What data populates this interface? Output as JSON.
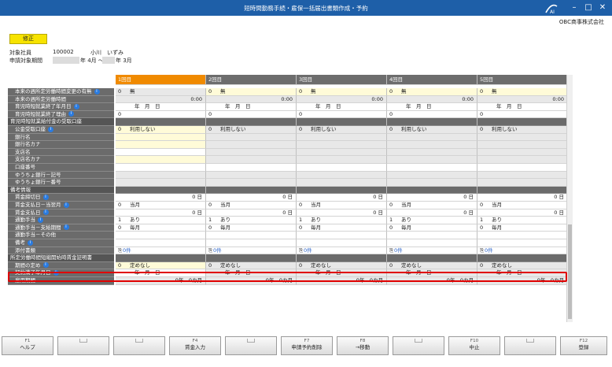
{
  "window": {
    "title": "短時間勤務手続・雇保一括届出書類作成・予約",
    "company": "OBC商事株式会社",
    "logo_text": "AI"
  },
  "status_button": "修正",
  "employee": {
    "label": "対象社員",
    "code": "100002",
    "name": "小川　いずみ"
  },
  "period": {
    "label": "申請対象期間",
    "start": "年 4月 ～",
    "end": "年 3月"
  },
  "columns": [
    "1回目",
    "2回目",
    "3回目",
    "4回目",
    "5回目"
  ],
  "rows": [
    {
      "label": "本来の週所定労働時間変更の有無",
      "info": true,
      "style": "yellow",
      "cells": [
        {
          "num": "0",
          "txt": "無",
          "gray": true
        },
        {
          "num": "0",
          "txt": "無"
        },
        {
          "num": "0",
          "txt": "無"
        },
        {
          "num": "0",
          "txt": "無"
        },
        {
          "num": "0",
          "txt": "無"
        }
      ]
    },
    {
      "label": "本来の週所定労働時間",
      "info": false,
      "style": "gray",
      "cells": [
        {
          "right": "0:00"
        },
        {
          "right": "0:00"
        },
        {
          "right": "0:00"
        },
        {
          "right": "0:00"
        },
        {
          "right": "0:00"
        }
      ]
    },
    {
      "label": "育児時短就業終了年月日",
      "info": true,
      "style": "white",
      "cells": [
        {
          "date": "年　月　日"
        },
        {
          "date": "年　月　日"
        },
        {
          "date": "年　月　日"
        },
        {
          "date": "年　月　日"
        },
        {
          "date": "年　月　日"
        }
      ]
    },
    {
      "label": "育児時短就業終了理由",
      "info": true,
      "style": "white",
      "cells": [
        {
          "num": "0"
        },
        {
          "num": "0"
        },
        {
          "num": "0"
        },
        {
          "num": "0"
        },
        {
          "num": "0"
        }
      ]
    },
    {
      "label": "育児時短就業給付金の受取口座",
      "section": true
    },
    {
      "label": "公金受取口座",
      "info": true,
      "style": "yellow",
      "cells": [
        {
          "num": "0",
          "txt": "利用しない"
        },
        {
          "num": "0",
          "txt": "利用しない",
          "gray": true
        },
        {
          "num": "0",
          "txt": "利用しない",
          "gray": true
        },
        {
          "num": "0",
          "txt": "利用しない",
          "gray": true
        },
        {
          "num": "0",
          "txt": "利用しない",
          "gray": true
        }
      ]
    },
    {
      "label": "銀行名",
      "info": false,
      "style": "lightyellow",
      "cells": [
        {},
        {},
        {},
        {},
        {}
      ]
    },
    {
      "label": "銀行名カナ",
      "info": false,
      "style": "lightyellow",
      "cells": [
        {},
        {},
        {},
        {},
        {}
      ]
    },
    {
      "label": "支店名",
      "info": false,
      "style": "mixed",
      "cells": [
        {},
        {},
        {},
        {},
        {}
      ]
    },
    {
      "label": "支店名カナ",
      "info": false,
      "style": "lightyellow",
      "cells": [
        {},
        {},
        {},
        {},
        {}
      ]
    },
    {
      "label": "口座番号",
      "info": false,
      "style": "white",
      "cells": [
        {},
        {},
        {},
        {},
        {}
      ]
    },
    {
      "label": "ゆうちょ銀行－記号",
      "info": false,
      "style": "gray",
      "cells": [
        {},
        {},
        {},
        {},
        {}
      ]
    },
    {
      "label": "ゆうちょ銀行－番号",
      "info": false,
      "style": "gray",
      "cells": [
        {},
        {},
        {},
        {},
        {}
      ]
    },
    {
      "label": "備考情報",
      "section": true
    },
    {
      "label": "賃金締切日",
      "info": true,
      "style": "white",
      "cells": [
        {
          "right": "0 日"
        },
        {
          "right": "0 日"
        },
        {
          "right": "0 日"
        },
        {
          "right": "0 日"
        },
        {
          "right": "0 日"
        }
      ]
    },
    {
      "label": "賃金支払日－当翌月",
      "info": true,
      "style": "white",
      "cells": [
        {
          "num": "0",
          "txt": "当月"
        },
        {
          "num": "0",
          "txt": "当月"
        },
        {
          "num": "0",
          "txt": "当月"
        },
        {
          "num": "0",
          "txt": "当月"
        },
        {
          "num": "0",
          "txt": "当月"
        }
      ]
    },
    {
      "label": "賃金支払日",
      "info": true,
      "style": "white",
      "cells": [
        {
          "right": "0 日"
        },
        {
          "right": "0 日"
        },
        {
          "right": "0 日"
        },
        {
          "right": "0 日"
        },
        {
          "right": "0 日"
        }
      ]
    },
    {
      "label": "通勤手当",
      "info": true,
      "style": "white",
      "cells": [
        {
          "num": "1",
          "txt": "あり"
        },
        {
          "num": "1",
          "txt": "あり"
        },
        {
          "num": "1",
          "txt": "あり"
        },
        {
          "num": "1",
          "txt": "あり"
        },
        {
          "num": "1",
          "txt": "あり"
        }
      ]
    },
    {
      "label": "通勤手当－支給期間",
      "info": true,
      "style": "white",
      "cells": [
        {
          "num": "0",
          "txt": "毎月"
        },
        {
          "num": "0",
          "txt": "毎月"
        },
        {
          "num": "0",
          "txt": "毎月"
        },
        {
          "num": "0",
          "txt": "毎月"
        },
        {
          "num": "0",
          "txt": "毎月"
        }
      ]
    },
    {
      "label": "通勤手当－その他",
      "info": false,
      "style": "white",
      "cells": [
        {},
        {},
        {},
        {},
        {}
      ]
    },
    {
      "label": "備考",
      "info": true,
      "style": "white",
      "cells": [
        {},
        {},
        {},
        {},
        {}
      ]
    },
    {
      "label": "添付書類",
      "info": false,
      "style": "white",
      "attach": true,
      "cells": [
        {
          "link": "0件"
        },
        {
          "link": "0件"
        },
        {
          "link": "0件"
        },
        {
          "link": "0件"
        },
        {
          "link": "0件"
        }
      ]
    },
    {
      "label": "所定労働時間短縮開始時賃金証明書",
      "section": true
    },
    {
      "label": "期間の定め",
      "info": true,
      "style": "yellow",
      "cells": [
        {
          "num": "0",
          "txt": "定めなし"
        },
        {
          "num": "0",
          "txt": "定めなし",
          "gray": true
        },
        {
          "num": "0",
          "txt": "定めなし",
          "gray": true
        },
        {
          "num": "0",
          "txt": "定めなし",
          "gray": true
        },
        {
          "num": "0",
          "txt": "定めなし",
          "gray": true
        }
      ]
    },
    {
      "label": "契約満了年月日",
      "info": true,
      "style": "white",
      "cells": [
        {
          "date": "年　月　日"
        },
        {
          "date": "年　月　日",
          "gray": true
        },
        {
          "date": "年　月　日",
          "gray": true
        },
        {
          "date": "年　月　日",
          "gray": true
        },
        {
          "date": "年　月　日",
          "gray": true
        }
      ]
    },
    {
      "label": "雇用期間",
      "info": false,
      "style": "gray",
      "cells": [
        {
          "right": "0年　0カ月"
        },
        {
          "right": "0年　0カ月"
        },
        {
          "right": "0年　0カ月"
        },
        {
          "right": "0年　0カ月"
        },
        {
          "right": "0年　0カ月"
        }
      ]
    }
  ],
  "function_keys": [
    {
      "key": "F1",
      "label": "ヘルプ"
    },
    {
      "key": "",
      "label": ""
    },
    {
      "key": "",
      "label": ""
    },
    {
      "key": "F4",
      "label": "賃金入力"
    },
    {
      "key": "",
      "label": ""
    },
    {
      "key": "F7",
      "label": "申請予約削除"
    },
    {
      "key": "F8",
      "label": "→移動"
    },
    {
      "key": "",
      "label": ""
    },
    {
      "key": "F10",
      "label": "中止"
    },
    {
      "key": "",
      "label": ""
    },
    {
      "key": "F12",
      "label": "登録"
    }
  ],
  "colors": {
    "titlebar": "#1e5fa8",
    "active_column": "#f08a00",
    "label_bg": "#6b6b6b",
    "input_yellow": "#fffbd8",
    "highlight": "#e00000",
    "link": "#2b63c8"
  }
}
